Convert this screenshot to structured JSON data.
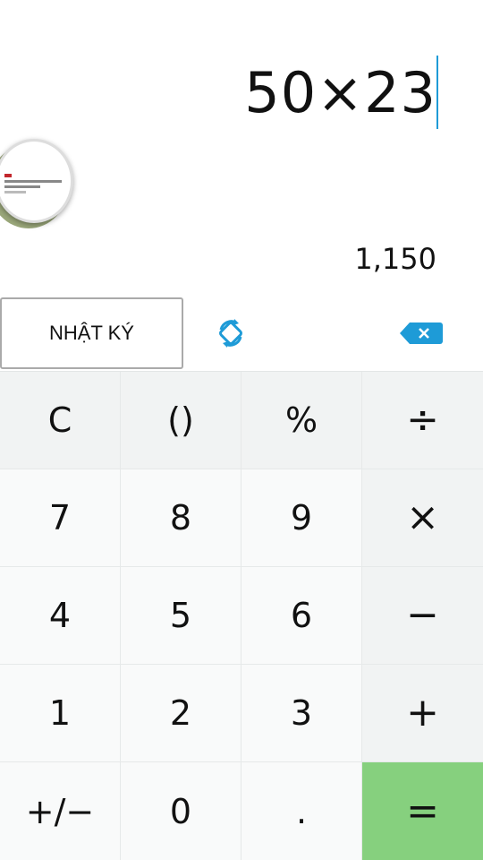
{
  "display": {
    "expression": "50×23",
    "result": "1,150"
  },
  "toolbar": {
    "history_label": "NHẬT KÝ",
    "rotate_icon": "rotate-icon",
    "backspace_icon": "backspace-icon"
  },
  "keypad": {
    "row1": [
      "C",
      "()",
      "%",
      "÷"
    ],
    "row2": [
      "7",
      "8",
      "9",
      "×"
    ],
    "row3": [
      "4",
      "5",
      "6",
      "−"
    ],
    "row4": [
      "1",
      "2",
      "3",
      "+"
    ],
    "row5": [
      "+/−",
      "0",
      ".",
      "="
    ]
  },
  "colors": {
    "accent": "#1e9bd7",
    "equals_bg": "#86d07e",
    "operator_bg": "#f1f3f3"
  }
}
